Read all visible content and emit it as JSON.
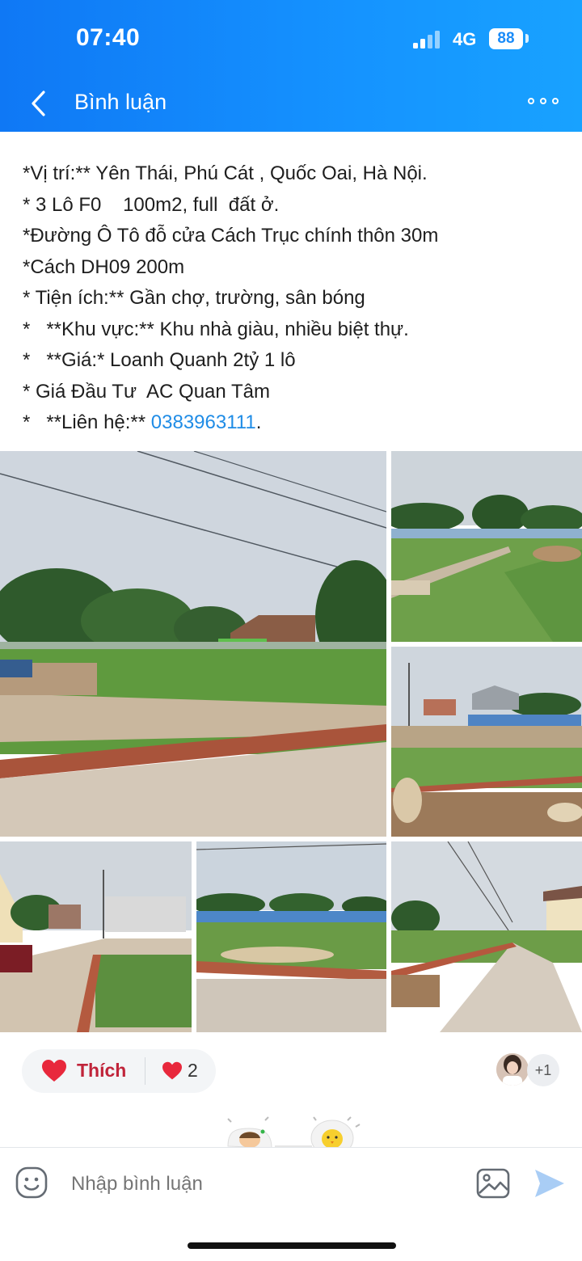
{
  "status_bar": {
    "time": "07:40",
    "network": "4G",
    "battery": "88"
  },
  "header": {
    "title": "Bình luận"
  },
  "post": {
    "lines": [
      "*Vị trí:** Yên Thái, Phú Cát , Quốc Oai, Hà Nội.",
      "* 3 Lô F0    100m2, full  đất ở.",
      "*Đường Ô Tô đỗ cửa Cách Trục chính thôn 30m",
      "*Cách DH09 200m",
      "* Tiện ích:** Gần chợ, trường, sân bóng",
      "*   **Khu vực:** Khu nhà giàu, nhiều biệt thự.",
      "*   **Giá:* Loanh Quanh 2tỷ 1 lô",
      "* Giá Đầu Tư  AC Quan Tâm"
    ],
    "contact_prefix": "*   **Liên hệ:** ",
    "phone": "0383963111",
    "contact_suffix": "."
  },
  "reactions": {
    "like_label": "Thích",
    "heart_count": "2",
    "others_badge": "+1"
  },
  "comment_bar": {
    "placeholder": "Nhập bình luận"
  },
  "colors": {
    "header_blue": "#1593ff",
    "link_blue": "#1f8ce6",
    "like_red": "#c0243a",
    "heart": "#e8283c"
  },
  "icons": [
    "back-icon",
    "more-icon",
    "heart-icon",
    "emoji-icon",
    "image-icon",
    "send-icon"
  ]
}
